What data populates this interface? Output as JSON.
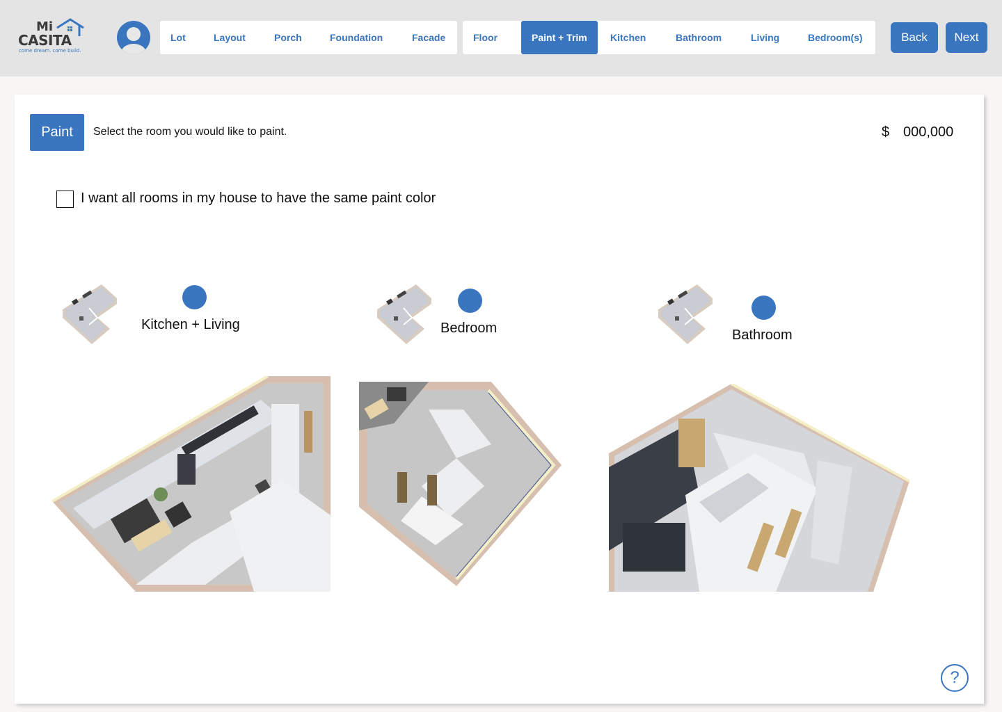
{
  "brand": {
    "line1": "Mi",
    "line2": "CASITA",
    "tagline": "come dream. come build."
  },
  "nav": {
    "group_a": [
      "Lot",
      "Layout",
      "Porch",
      "Foundation",
      "Facade"
    ],
    "group_b": [
      "Floor",
      "Paint + Trim",
      "Kitchen",
      "Bathroom",
      "Living",
      "Bedroom(s)"
    ],
    "active": "Paint + Trim"
  },
  "buttons": {
    "back": "Back",
    "next": "Next"
  },
  "section": {
    "button_label": "Paint",
    "instruction": "Select the room you would like to paint.",
    "currency": "$",
    "price": "000,000"
  },
  "same_color": {
    "label": "I want all rooms in my house to have the same paint color",
    "checked": false
  },
  "rooms": [
    {
      "name": "Kitchen + Living"
    },
    {
      "name": "Bedroom"
    },
    {
      "name": "Bathroom"
    }
  ],
  "colors": {
    "accent": "#3a76c0",
    "topbar": "#e4e4e4"
  },
  "icons": {
    "help": "?"
  }
}
